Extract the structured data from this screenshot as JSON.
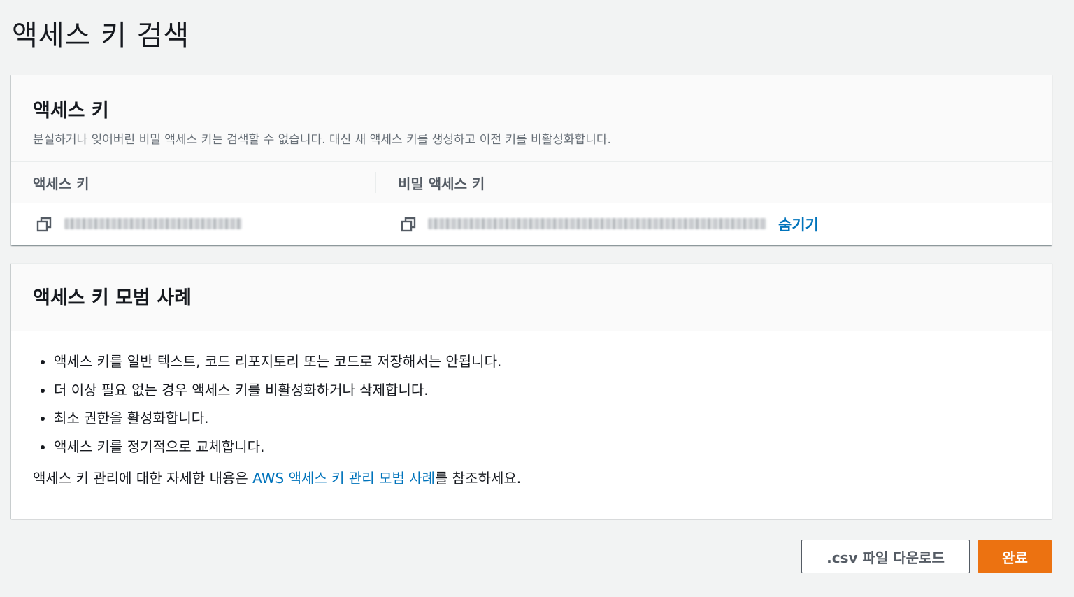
{
  "page": {
    "title": "액세스 키 검색"
  },
  "access_key_panel": {
    "title": "액세스 키",
    "description": "분실하거나 잊어버린 비밀 액세스 키는 검색할 수 없습니다. 대신 새 액세스 키를 생성하고 이전 키를 비활성화합니다.",
    "columns": {
      "access_key": "액세스 키",
      "secret_key": "비밀 액세스 키"
    },
    "row": {
      "access_key_value": "",
      "secret_key_value": "",
      "hide_label": "숨기기",
      "copy_icon": "copy-icon"
    }
  },
  "best_practices_panel": {
    "title": "액세스 키 모범 사례",
    "items": [
      "액세스 키를 일반 텍스트, 코드 리포지토리 또는 코드로 저장해서는 안됩니다.",
      "더 이상 필요 없는 경우 액세스 키를 비활성화하거나 삭제합니다.",
      "최소 권한을 활성화합니다.",
      "액세스 키를 정기적으로 교체합니다."
    ],
    "note_prefix": "액세스 키 관리에 대한 자세한 내용은 ",
    "note_link": "AWS 액세스 키 관리 모범 사례",
    "note_suffix": "를 참조하세요."
  },
  "actions": {
    "download_csv": ".csv 파일 다운로드",
    "done": "완료"
  },
  "colors": {
    "primary": "#ec7211",
    "link": "#0073bb",
    "background": "#f2f3f3"
  }
}
